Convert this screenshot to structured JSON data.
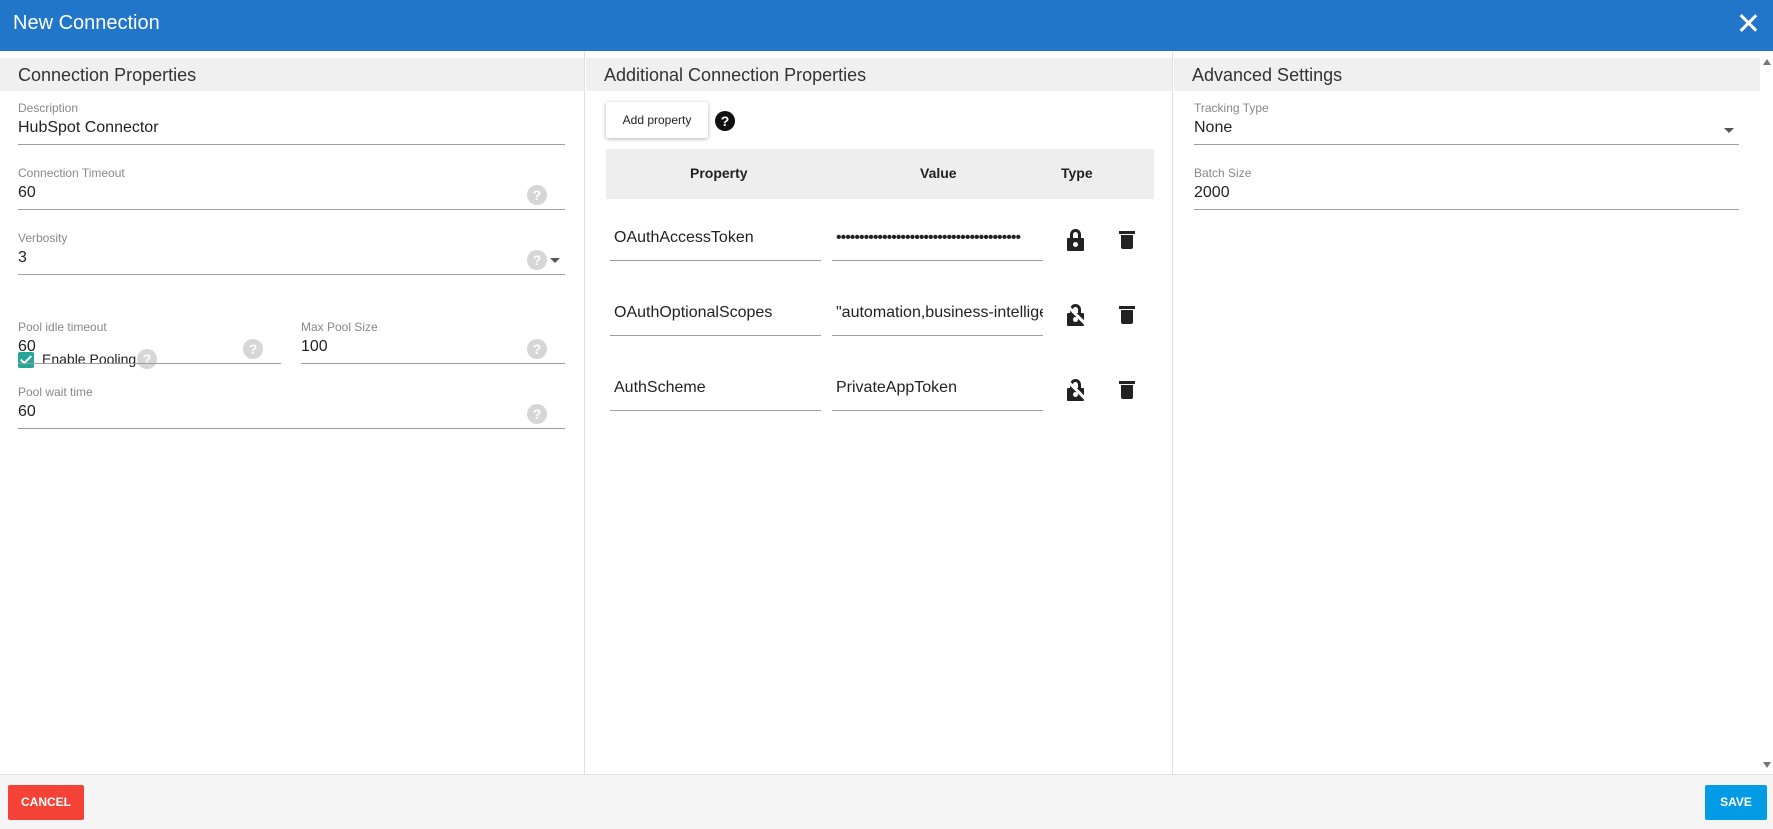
{
  "window": {
    "title": "New Connection",
    "close_icon": "close-icon"
  },
  "connection_properties": {
    "heading": "Connection Properties",
    "description": {
      "label": "Description",
      "value": "HubSpot Connector"
    },
    "connection_timeout": {
      "label": "Connection Timeout",
      "value": "60"
    },
    "verbosity": {
      "label": "Verbosity",
      "value": "3"
    },
    "enable_pooling": {
      "label": "Enable Pooling",
      "checked": true
    },
    "pool_idle_timeout": {
      "label": "Pool idle timeout",
      "value": "60"
    },
    "max_pool_size": {
      "label": "Max Pool Size",
      "value": "100"
    },
    "pool_wait_time": {
      "label": "Pool wait time",
      "value": "60"
    },
    "help_glyph": "?"
  },
  "additional_properties": {
    "heading": "Additional Connection Properties",
    "add_button": "Add property",
    "help_glyph": "?",
    "columns": [
      "Property",
      "Value",
      "Type"
    ],
    "rows": [
      {
        "property": "OAuthAccessToken",
        "value": "••••••••••••••••••••••••••••••••••••••••",
        "type_icon": "lock-icon"
      },
      {
        "property": "OAuthOptionalScopes",
        "value": "\"automation,business-intelligence",
        "type_icon": "unlocked-icon"
      },
      {
        "property": "AuthScheme",
        "value": "PrivateAppToken",
        "type_icon": "unlocked-icon"
      }
    ]
  },
  "advanced_settings": {
    "heading": "Advanced Settings",
    "tracking_type": {
      "label": "Tracking Type",
      "value": "None"
    },
    "batch_size": {
      "label": "Batch Size",
      "value": "2000"
    }
  },
  "footer": {
    "cancel": "CANCEL",
    "save": "SAVE"
  },
  "colors": {
    "title_bar": "#2176c9",
    "cancel": "#f44336",
    "save": "#039be5",
    "checkbox": "#26a69a"
  }
}
